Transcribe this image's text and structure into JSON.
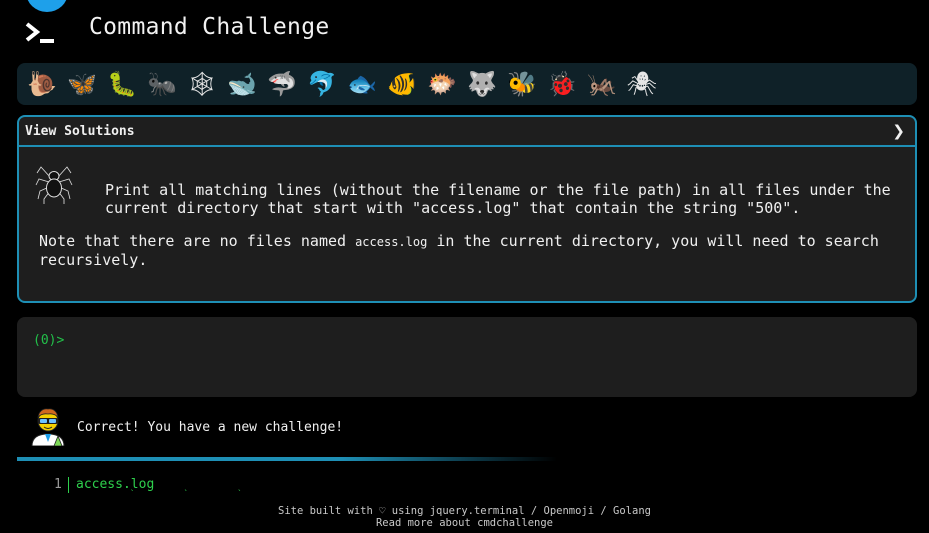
{
  "header": {
    "title": "Command Challenge",
    "logo_icon": "terminal-prompt-icon",
    "accent": "#1ea0ea"
  },
  "levels": [
    {
      "name": "snail-icon",
      "glyph": "🐌"
    },
    {
      "name": "butterfly-icon",
      "glyph": "🦋"
    },
    {
      "name": "caterpillar-icon",
      "glyph": "🐛"
    },
    {
      "name": "ant-icon",
      "glyph": "🐜"
    },
    {
      "name": "spider-web-icon",
      "glyph": "🕸"
    },
    {
      "name": "whale-icon",
      "glyph": "🐋"
    },
    {
      "name": "shark-icon",
      "glyph": "🦈"
    },
    {
      "name": "dolphin-icon",
      "glyph": "🐬"
    },
    {
      "name": "fish-icon",
      "glyph": "🐟"
    },
    {
      "name": "tropical-fish-icon",
      "glyph": "🐠"
    },
    {
      "name": "blowfish-icon",
      "glyph": "🐡"
    },
    {
      "name": "wolf-icon",
      "glyph": "🐺"
    },
    {
      "name": "bee-icon",
      "glyph": "🐝"
    },
    {
      "name": "ladybug-icon",
      "glyph": "🐞"
    },
    {
      "name": "cricket-icon",
      "glyph": "🦗"
    },
    {
      "name": "spider-icon",
      "glyph": "🕷"
    }
  ],
  "panel": {
    "header_label": "View Solutions",
    "chevron": "❯",
    "task": "Print all matching lines (without the filename or the file path) in all files under the current directory that start with \"access.log\" that contain the string \"500\".",
    "note_prefix": "Note that there are no files named ",
    "note_code": "access.log",
    "note_suffix": " in the current directory, you will need to search recursively."
  },
  "terminal": {
    "prompt": "(0)>"
  },
  "result": {
    "message": "Correct! You have a new challenge!",
    "progress": 0.6
  },
  "output": {
    "line_number": "1",
    "text": "access.log",
    "ticks": "` ` `"
  },
  "footer": {
    "line1": "Site built with ♡ using jquery.terminal / Openmoji / Golang",
    "line2": "Read more about cmdchallenge"
  },
  "colors": {
    "panel_border": "#1e8fb5",
    "prompt_green": "#22c14a",
    "background": "#000000"
  }
}
